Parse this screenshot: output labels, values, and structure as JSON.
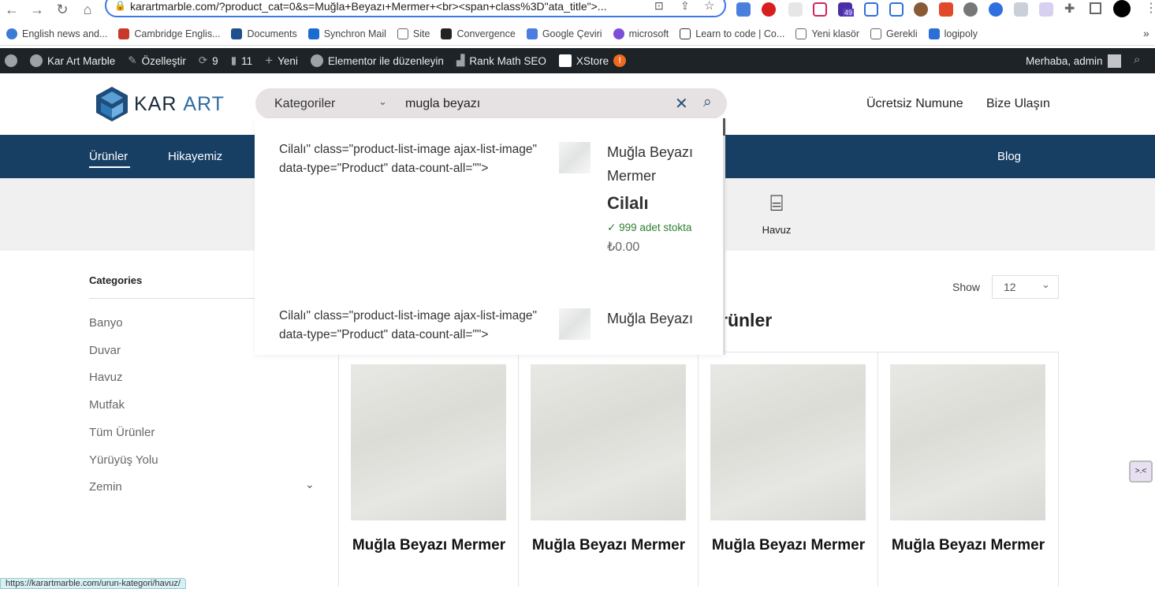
{
  "browser": {
    "url": "karartmarble.com/?product_cat=0&s=Muğla+Beyazı+Mermer+<br><span+class%3D\"ata_title\">...",
    "extension_badge": "49",
    "bookmarks": [
      "English news and...",
      "Cambridge Englis...",
      "Documents",
      "Synchron Mail",
      "Site",
      "Convergence",
      "Google Çeviri",
      "microsoft",
      "Learn to code | Co...",
      "Yeni klasör",
      "Gerekli",
      "logipoly"
    ],
    "more": "»",
    "status_url": "https://karartmarble.com/urun-kategori/havuz/"
  },
  "adminbar": {
    "site": "Kar Art Marble",
    "customize": "Özelleştir",
    "updates": "9",
    "comments": "11",
    "new": "Yeni",
    "elementor": "Elementor ile düzenleyin",
    "rankmath": "Rank Math SEO",
    "xstore": "XStore",
    "xstore_alert": "!",
    "greeting": "Merhaba, admin"
  },
  "header": {
    "logo_kar": "KAR",
    "logo_art": "ART",
    "search": {
      "category": "Kategoriler",
      "query": "mugla beyazı"
    },
    "links": [
      "Ücretsiz Numune",
      "Bize Ulaşın"
    ]
  },
  "nav": {
    "items": [
      "Ürünler",
      "Hikayemiz"
    ],
    "right": "Blog"
  },
  "band": {
    "category": "Havuz"
  },
  "results": [
    {
      "code": "Cilalı\" class=\"product-list-image ajax-list-image\" data-type=\"Product\" data-count-all=\"\">",
      "title": "Muğla Beyazı Mermer",
      "subtitle": "Cilalı",
      "stock": "999 adet stokta",
      "price": "₺0.00"
    },
    {
      "code": "Cilalı\" class=\"product-list-image ajax-list-image\" data-type=\"Product\" data-count-all=\"\">",
      "title": "Muğla Beyazı"
    }
  ],
  "sidebar": {
    "heading": "Categories",
    "items": [
      "Banyo",
      "Duvar",
      "Havuz",
      "Mutfak",
      "Tüm Ürünler",
      "Yürüyüş Yolu",
      "Zemin"
    ]
  },
  "shop": {
    "show_label": "Show",
    "per_page": "12",
    "heading_partial": "rünler"
  },
  "products": [
    {
      "name": "Muğla Beyazı Mermer"
    },
    {
      "name": "Muğla Beyazı Mermer"
    },
    {
      "name": "Muğla Beyazı Mermer"
    },
    {
      "name": "Muğla Beyazı Mermer"
    }
  ]
}
